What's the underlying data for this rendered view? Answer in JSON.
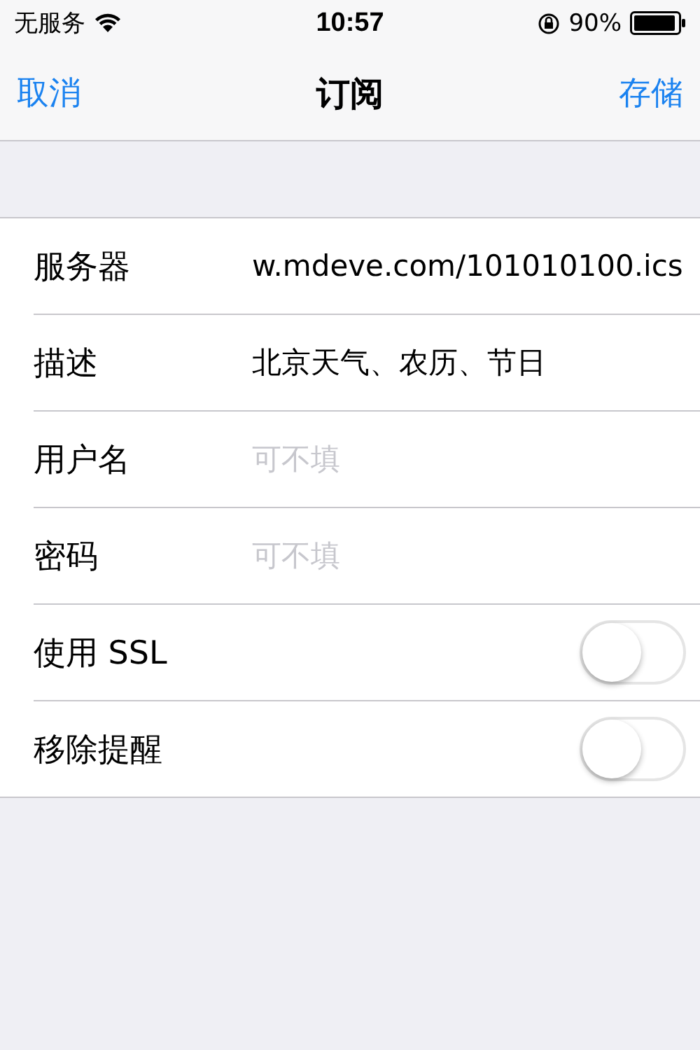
{
  "status_bar": {
    "carrier": "无服务",
    "time": "10:57",
    "battery": "90%"
  },
  "nav": {
    "left": "取消",
    "title": "订阅",
    "right": "存储"
  },
  "rows": [
    {
      "kind": "field",
      "label": "服务器",
      "value": "w.mdeve.com/101010100.ics"
    },
    {
      "kind": "field",
      "label": "描述",
      "value": "北京天气、农历、节日"
    },
    {
      "kind": "field",
      "label": "用户名",
      "placeholder": "可不填"
    },
    {
      "kind": "field",
      "label": "密码",
      "placeholder": "可不填"
    },
    {
      "kind": "toggle",
      "label": "使用 SSL",
      "on": false
    },
    {
      "kind": "toggle",
      "label": "移除提醒",
      "on": false
    }
  ]
}
